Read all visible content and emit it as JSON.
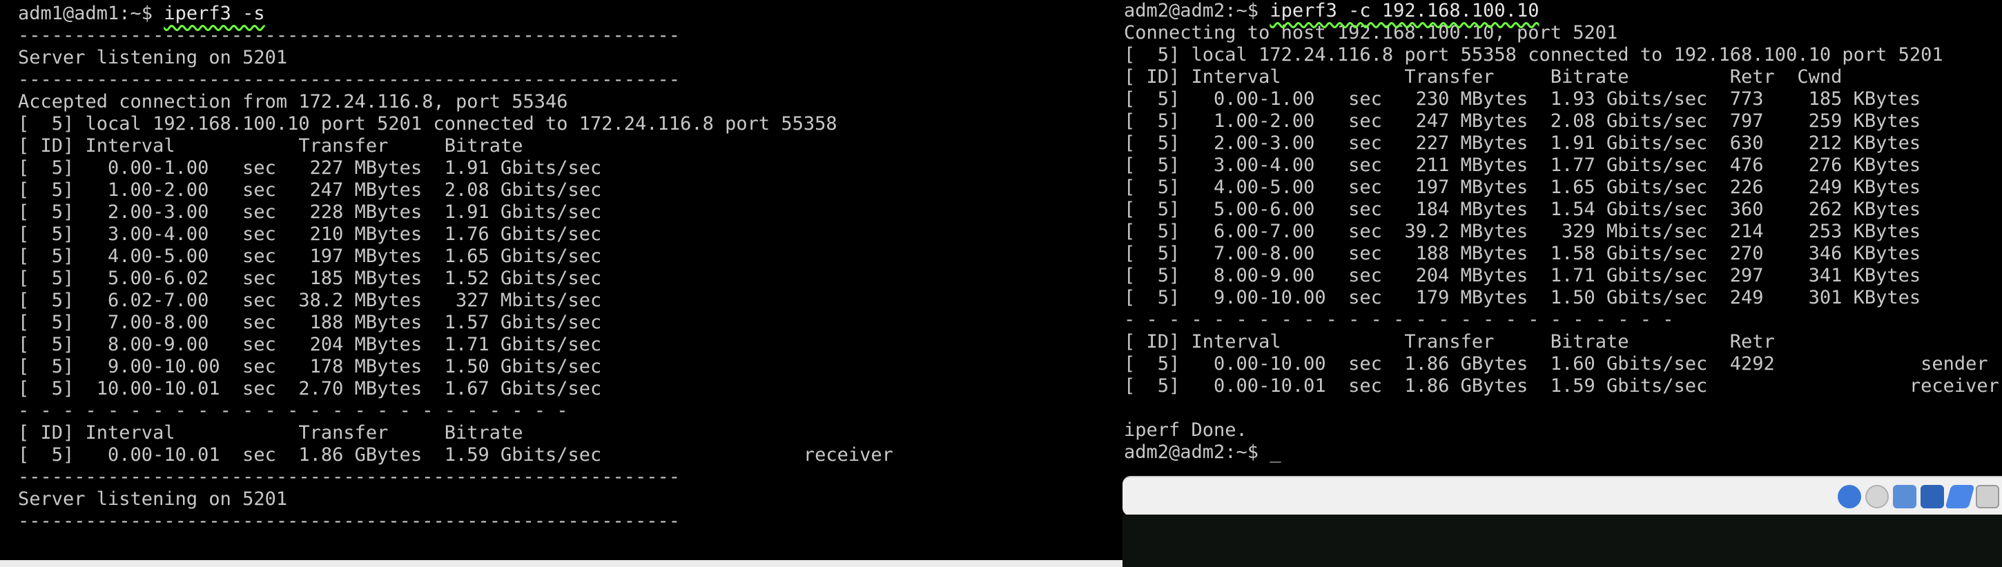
{
  "left_terminal": {
    "lines": [
      {
        "prompt": "adm1@adm1:~$ ",
        "cmd": "iperf3 -s"
      },
      {
        "text": "-----------------------------------------------------------"
      },
      {
        "text": "Server listening on 5201"
      },
      {
        "text": "-----------------------------------------------------------"
      },
      {
        "text": "Accepted connection from 172.24.116.8, port 55346"
      },
      {
        "text": "[  5] local 192.168.100.10 port 5201 connected to 172.24.116.8 port 55358"
      },
      {
        "text": "[ ID] Interval           Transfer     Bitrate"
      },
      {
        "text": "[  5]   0.00-1.00   sec   227 MBytes  1.91 Gbits/sec"
      },
      {
        "text": "[  5]   1.00-2.00   sec   247 MBytes  2.08 Gbits/sec"
      },
      {
        "text": "[  5]   2.00-3.00   sec   228 MBytes  1.91 Gbits/sec"
      },
      {
        "text": "[  5]   3.00-4.00   sec   210 MBytes  1.76 Gbits/sec"
      },
      {
        "text": "[  5]   4.00-5.00   sec   197 MBytes  1.65 Gbits/sec"
      },
      {
        "text": "[  5]   5.00-6.02   sec   185 MBytes  1.52 Gbits/sec"
      },
      {
        "text": "[  5]   6.02-7.00   sec  38.2 MBytes   327 Mbits/sec"
      },
      {
        "text": "[  5]   7.00-8.00   sec   188 MBytes  1.57 Gbits/sec"
      },
      {
        "text": "[  5]   8.00-9.00   sec   204 MBytes  1.71 Gbits/sec"
      },
      {
        "text": "[  5]   9.00-10.00  sec   178 MBytes  1.50 Gbits/sec"
      },
      {
        "text": "[  5]  10.00-10.01  sec  2.70 MBytes  1.67 Gbits/sec"
      },
      {
        "text": "- - - - - - - - - - - - - - - - - - - - - - - - -"
      },
      {
        "text": "[ ID] Interval           Transfer     Bitrate"
      },
      {
        "text": "[  5]   0.00-10.01  sec  1.86 GBytes  1.59 Gbits/sec                  receiver"
      },
      {
        "text": "-----------------------------------------------------------"
      },
      {
        "text": "Server listening on 5201"
      },
      {
        "text": "-----------------------------------------------------------"
      },
      {
        "text": ""
      },
      {
        "cursor": "_"
      }
    ]
  },
  "right_terminal": {
    "lines": [
      {
        "prompt": "adm2@adm2:~$ ",
        "cmd": "iperf3 -c 192.168.100.10"
      },
      {
        "text": "Connecting to host 192.168.100.10, port 5201"
      },
      {
        "text": "[  5] local 172.24.116.8 port 55358 connected to 192.168.100.10 port 5201"
      },
      {
        "text": "[ ID] Interval           Transfer     Bitrate         Retr  Cwnd"
      },
      {
        "text": "[  5]   0.00-1.00   sec   230 MBytes  1.93 Gbits/sec  773    185 KBytes"
      },
      {
        "text": "[  5]   1.00-2.00   sec   247 MBytes  2.08 Gbits/sec  797    259 KBytes"
      },
      {
        "text": "[  5]   2.00-3.00   sec   227 MBytes  1.91 Gbits/sec  630    212 KBytes"
      },
      {
        "text": "[  5]   3.00-4.00   sec   211 MBytes  1.77 Gbits/sec  476    276 KBytes"
      },
      {
        "text": "[  5]   4.00-5.00   sec   197 MBytes  1.65 Gbits/sec  226    249 KBytes"
      },
      {
        "text": "[  5]   5.00-6.00   sec   184 MBytes  1.54 Gbits/sec  360    262 KBytes"
      },
      {
        "text": "[  5]   6.00-7.00   sec  39.2 MBytes   329 Mbits/sec  214    253 KBytes"
      },
      {
        "text": "[  5]   7.00-8.00   sec   188 MBytes  1.58 Gbits/sec  270    346 KBytes"
      },
      {
        "text": "[  5]   8.00-9.00   sec   204 MBytes  1.71 Gbits/sec  297    341 KBytes"
      },
      {
        "text": "[  5]   9.00-10.00  sec   179 MBytes  1.50 Gbits/sec  249    301 KBytes"
      },
      {
        "text": "- - - - - - - - - - - - - - - - - - - - - - - - -"
      },
      {
        "text": "[ ID] Interval           Transfer     Bitrate         Retr"
      },
      {
        "text": "[  5]   0.00-10.00  sec  1.86 GBytes  1.60 Gbits/sec  4292             sender"
      },
      {
        "text": "[  5]   0.00-10.01  sec  1.86 GBytes  1.59 Gbits/sec                  receiver"
      },
      {
        "text": ""
      },
      {
        "text": "iperf Done."
      },
      {
        "prompt": "adm2@adm2:~$ ",
        "cursor": "_"
      }
    ]
  },
  "vbox_tray": {
    "icons": [
      "network-icon",
      "optical-drive-icon",
      "usb-icon",
      "shared-folders-icon",
      "recording-icon",
      "display-icon"
    ]
  }
}
